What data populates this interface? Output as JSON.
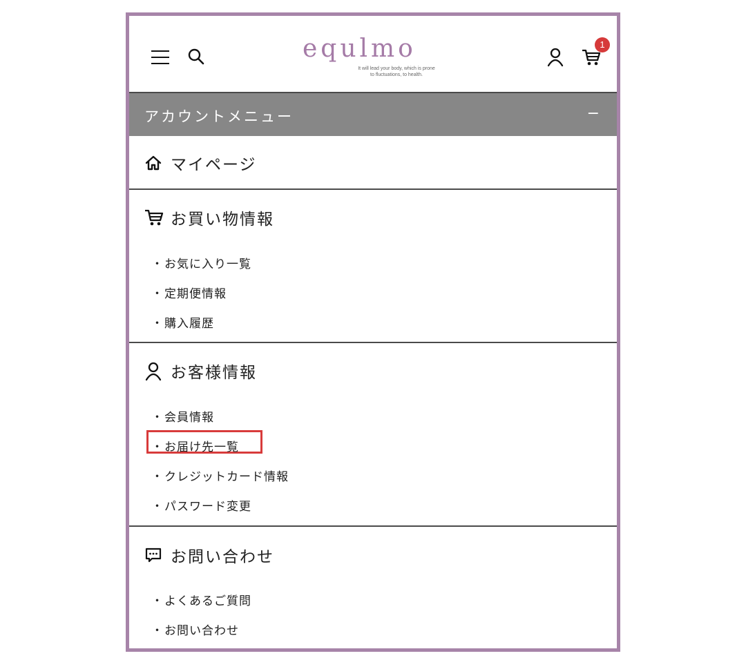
{
  "header": {
    "logo_text": "equlmo",
    "logo_tagline_1": "It will lead your body, which is prone",
    "logo_tagline_2": "to fluctuations, to health.",
    "cart_count": "1",
    "accent": "#a57ba7",
    "badge_color": "#d63a3a"
  },
  "menu": {
    "title": "アカウントメニュー",
    "toggle": "−"
  },
  "sections": {
    "mypage": {
      "label": "マイページ",
      "icon": "home-icon"
    },
    "shopping": {
      "label": "お買い物情報",
      "icon": "cart-icon",
      "items": [
        "お気に入り一覧",
        "定期便情報",
        "購入履歴"
      ]
    },
    "customer": {
      "label": "お客様情報",
      "icon": "person-icon",
      "items": [
        "会員情報",
        "お届け先一覧",
        "クレジットカード情報",
        "パスワード変更"
      ]
    },
    "contact": {
      "label": "お問い合わせ",
      "icon": "chat-icon",
      "items": [
        "よくあるご質問",
        "お問い合わせ"
      ]
    }
  },
  "bullet": "・",
  "highlight_color": "#d83b3b"
}
